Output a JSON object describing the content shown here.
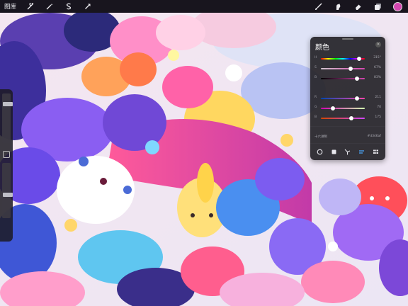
{
  "toolbar": {
    "gallery_label": "图库",
    "left_tools": [
      "wrench-icon",
      "magic-wand-icon",
      "selection-s-icon",
      "transform-arrow-icon"
    ],
    "right_tools": [
      "brush-icon",
      "smudge-icon",
      "eraser-icon",
      "layers-icon"
    ],
    "current_color": "#d346af"
  },
  "sidebar": {
    "brush_size_level": 0.18,
    "opacity_level": 0.58
  },
  "color_panel": {
    "title": "颜色",
    "hsb": [
      {
        "label": "H",
        "value": "315°",
        "fraction": 0.875
      },
      {
        "label": "S",
        "value": "67%",
        "fraction": 0.67
      },
      {
        "label": "B",
        "value": "83%",
        "fraction": 0.83
      }
    ],
    "rgb": [
      {
        "label": "R",
        "value": "211",
        "fraction": 0.83
      },
      {
        "label": "G",
        "value": "70",
        "fraction": 0.27
      },
      {
        "label": "B",
        "value": "175",
        "fraction": 0.69
      }
    ],
    "hex_label": "十六进制",
    "hex_value": "#d346af",
    "tabs": [
      "disc-tab",
      "classic-tab",
      "harmony-tab",
      "value-tab",
      "palettes-tab"
    ],
    "active_tab": "value-tab"
  }
}
